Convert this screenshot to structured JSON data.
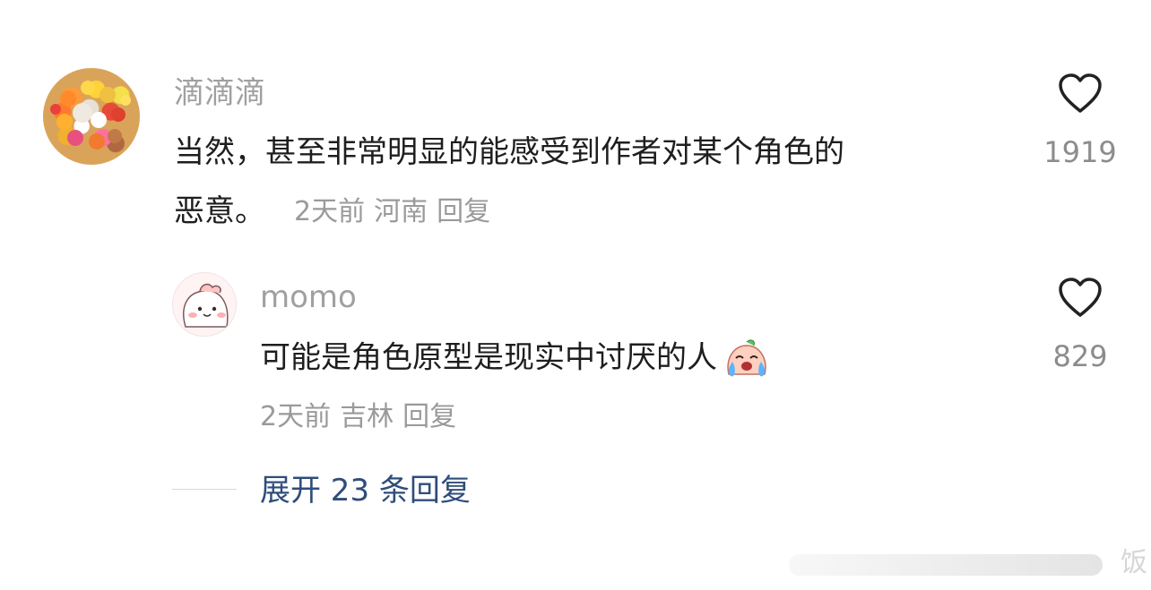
{
  "comments": [
    {
      "username": "滴滴滴",
      "text_line1": "当然，甚至非常明显的能感受到作者对某个角色的",
      "text_line2": "恶意。",
      "time": "2天前",
      "location": "河南",
      "reply_label": "回复",
      "likes": "1919",
      "avatar_icon": "colorful-toys-avatar",
      "like_icon": "heart-outline-icon"
    },
    {
      "username": "momo",
      "text": "可能是角色原型是现实中讨厌的人",
      "emoji": "crying-peach-emoji",
      "time": "2天前",
      "location": "吉林",
      "reply_label": "回复",
      "likes": "829",
      "avatar_icon": "pink-cartoon-avatar",
      "like_icon": "heart-outline-icon"
    }
  ],
  "expand_replies": "展开 23 条回复",
  "watermark_text": "饭",
  "colors": {
    "username": "#a0a0a0",
    "text": "#1e1e1e",
    "meta": "#9a9a9a",
    "link": "#2f4d7a"
  }
}
